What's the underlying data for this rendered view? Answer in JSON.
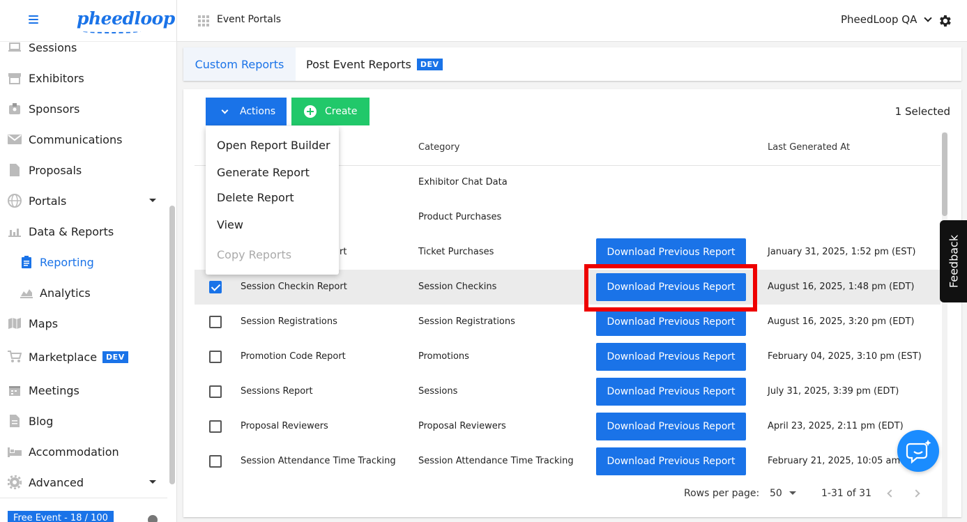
{
  "sidebar": {
    "items": [
      {
        "label": "Sessions",
        "icon": "laptop-icon"
      },
      {
        "label": "Exhibitors",
        "icon": "storefront-icon"
      },
      {
        "label": "Sponsors",
        "icon": "badge-icon"
      },
      {
        "label": "Communications",
        "icon": "mail-icon"
      },
      {
        "label": "Proposals",
        "icon": "document-icon"
      },
      {
        "label": "Portals",
        "icon": "globe-icon"
      },
      {
        "label": "Data & Reports",
        "icon": "chart-icon"
      },
      {
        "label": "Reporting",
        "icon": "clipboard-icon"
      },
      {
        "label": "Analytics",
        "icon": "analytics-icon"
      },
      {
        "label": "Maps",
        "icon": "map-icon"
      },
      {
        "label": "Marketplace",
        "icon": "cart-icon",
        "badge": "DEV"
      },
      {
        "label": "Meetings",
        "icon": "calendar-icon"
      },
      {
        "label": "Blog",
        "icon": "blog-icon"
      },
      {
        "label": "Accommodation",
        "icon": "bed-icon"
      },
      {
        "label": "Advanced",
        "icon": "cog-icon"
      }
    ],
    "footer": {
      "plan_label": "Free Event - 18 / 100"
    }
  },
  "topbar": {
    "section_title": "Event Portals",
    "org_name": "PheedLoop QA"
  },
  "tabs": [
    {
      "label": "Custom Reports"
    },
    {
      "label": "Post Event Reports",
      "badge": "DEV"
    }
  ],
  "toolbar": {
    "actions_label": "Actions",
    "create_label": "Create",
    "selected_text": "1 Selected"
  },
  "menu": {
    "items": [
      "Open Report Builder",
      "Generate Report",
      "Delete Report",
      "View",
      "Copy Reports"
    ]
  },
  "table": {
    "headers": {
      "category": "Category",
      "last_generated": "Last Generated At"
    },
    "download_label": "Download Previous Report",
    "rows": [
      {
        "name": "",
        "category": "Exhibitor Chat Data",
        "date": "",
        "checked": false,
        "has_download": false
      },
      {
        "name": "",
        "category": "Product Purchases",
        "date": "",
        "checked": false,
        "has_download": false
      },
      {
        "name": "rt",
        "category": "Ticket Purchases",
        "date": "January 31, 2025, 1:52 pm (EST)",
        "checked": false,
        "has_download": true
      },
      {
        "name": "Session Checkin Report",
        "category": "Session Checkins",
        "date": "August 16, 2025, 1:48 pm (EDT)",
        "checked": true,
        "has_download": true
      },
      {
        "name": "Session Registrations",
        "category": "Session Registrations",
        "date": "August 16, 2025, 3:20 pm (EDT)",
        "checked": false,
        "has_download": true
      },
      {
        "name": "Promotion Code Report",
        "category": "Promotions",
        "date": "February 04, 2025, 3:10 pm (EST)",
        "checked": false,
        "has_download": true
      },
      {
        "name": "Sessions Report",
        "category": "Sessions",
        "date": "July 31, 2025, 3:39 pm (EDT)",
        "checked": false,
        "has_download": true
      },
      {
        "name": "Proposal Reviewers",
        "category": "Proposal Reviewers",
        "date": "April 23, 2025, 2:11 pm (EDT)",
        "checked": false,
        "has_download": true
      },
      {
        "name": "Session Attendance Time Tracking",
        "category": "Session Attendance Time Tracking",
        "date": "February 21, 2025, 10:05 am (E",
        "checked": false,
        "has_download": true
      }
    ]
  },
  "pagination": {
    "rows_per_page_label": "Rows per page:",
    "rows_per_page_value": "50",
    "range_text": "1-31 of 31"
  },
  "feedback": {
    "label": "Feedback"
  },
  "colors": {
    "primary": "#1a73e8",
    "create_green": "#21c86a",
    "highlight_red": "#ee0000"
  }
}
